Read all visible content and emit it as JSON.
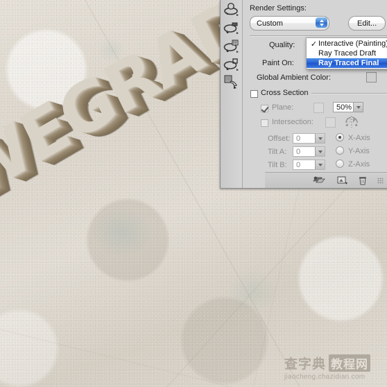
{
  "document": {
    "artwork_text": "WEGRAD",
    "background": "concrete-texture"
  },
  "panel": {
    "title": "Render Settings:",
    "preset": {
      "value": "Custom",
      "edit_label": "Edit..."
    },
    "quality": {
      "label": "Quality:",
      "options": [
        {
          "label": "Interactive (Painting)",
          "checked": true,
          "selected": false
        },
        {
          "label": "Ray Traced Draft",
          "checked": false,
          "selected": false
        },
        {
          "label": "Ray Traced Final",
          "checked": false,
          "selected": true
        }
      ],
      "check_glyph": "✓"
    },
    "paint_on": {
      "label": "Paint On:"
    },
    "global_ambient": {
      "label": "Global Ambient Color:",
      "swatch": "#cfcfcf"
    },
    "cross_section": {
      "label": "Cross Section",
      "enabled": false,
      "plane": {
        "label": "Plane:",
        "checked": true,
        "opacity": "50%",
        "swatch": "#d9d9d9"
      },
      "intersection": {
        "label": "Intersection:",
        "checked": false,
        "swatch": "#d9d9d9",
        "icon": "flip-section-icon"
      },
      "offset": {
        "label": "Offset:",
        "value": "0"
      },
      "tilt_a": {
        "label": "Tilt A:",
        "value": "0"
      },
      "tilt_b": {
        "label": "Tilt B:",
        "value": "0"
      },
      "axes": [
        {
          "label": "X-Axis",
          "selected": true
        },
        {
          "label": "Y-Axis",
          "selected": false
        },
        {
          "label": "Z-Axis",
          "selected": false
        }
      ]
    },
    "tools": [
      {
        "name": "rotate-3d-object-tool"
      },
      {
        "name": "roll-3d-object-tool"
      },
      {
        "name": "pan-3d-object-tool"
      },
      {
        "name": "slide-3d-object-tool"
      },
      {
        "name": "scale-3d-object-tool"
      }
    ],
    "footer": [
      {
        "name": "toggle-ground-plane-button"
      },
      {
        "name": "new-light-button"
      },
      {
        "name": "delete-light-button"
      },
      {
        "name": "panel-resize-grip"
      }
    ]
  },
  "watermark": {
    "cn_left": "查字典",
    "cn_box": "教程网",
    "url": "jiaocheng.chazidian.com"
  },
  "colors": {
    "accent_blue": "#2a63d6",
    "panel_bg": "#d4d4d4",
    "text_face": "#d9d3c7",
    "text_extrude": "#857660",
    "concrete": "#dcd7ce"
  }
}
